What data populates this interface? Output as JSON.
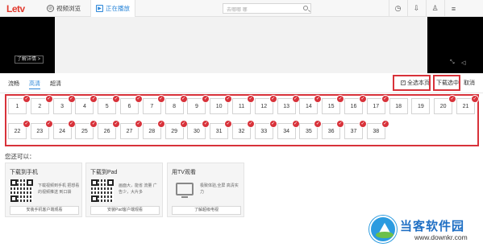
{
  "app": {
    "logo": "Letv"
  },
  "tabs": [
    {
      "label": "视频浏览",
      "icon": "globe-icon"
    },
    {
      "label": "正在播放",
      "icon": "play-icon"
    }
  ],
  "search": {
    "placeholder": "去哪哪 哪"
  },
  "toolbar": {
    "history_icon": "clock-icon",
    "download_icon": "download-icon",
    "user_icon": "user-icon",
    "settings_icon": "settings-icon"
  },
  "player": {
    "detail_label": "了解详情 >"
  },
  "quality": {
    "options": [
      "流畅",
      "高清",
      "超清"
    ],
    "selected": "高清",
    "select_all": "全选本页",
    "download_selected": "下载选中",
    "cancel": "取消"
  },
  "episodes": [
    "1",
    "2",
    "3",
    "4",
    "5",
    "6",
    "7",
    "8",
    "9",
    "10",
    "11",
    "12",
    "13",
    "14",
    "15",
    "16",
    "17",
    "18",
    "19",
    "20",
    "21",
    "22",
    "23",
    "24",
    "25",
    "26",
    "27",
    "28",
    "29",
    "30",
    "31",
    "32",
    "33",
    "34",
    "35",
    "36",
    "37",
    "38"
  ],
  "checked_episodes": [
    "1",
    "2",
    "3",
    "4",
    "5",
    "6",
    "7",
    "8",
    "9",
    "10",
    "11",
    "12",
    "13",
    "14",
    "15",
    "16",
    "17",
    "20",
    "21",
    "22",
    "23",
    "24",
    "25",
    "26",
    "27",
    "28",
    "29",
    "30",
    "31",
    "32",
    "33",
    "34",
    "35",
    "36",
    "37",
    "38"
  ],
  "bottom": {
    "heading": "您还可以：",
    "cards": [
      {
        "title": "下载到手机",
        "desc": "下载视频到手机 把想看的视频推送 到口袋",
        "button": "安装手机客户端观看"
      },
      {
        "title": "下载到Pad",
        "desc": "画面大，能省 流量 广告少，大片多",
        "button": "安装Pad客户端观看"
      },
      {
        "title": "用TV观看",
        "desc": "极致体验,全屏 高清实力",
        "button": "了解超级电视"
      }
    ]
  },
  "watermark": {
    "name": "当客软件园",
    "url": "www.downkr.com"
  },
  "colors": {
    "accent": "#2b86d8",
    "highlight": "#d8323a",
    "logo": "#e23a2e"
  }
}
